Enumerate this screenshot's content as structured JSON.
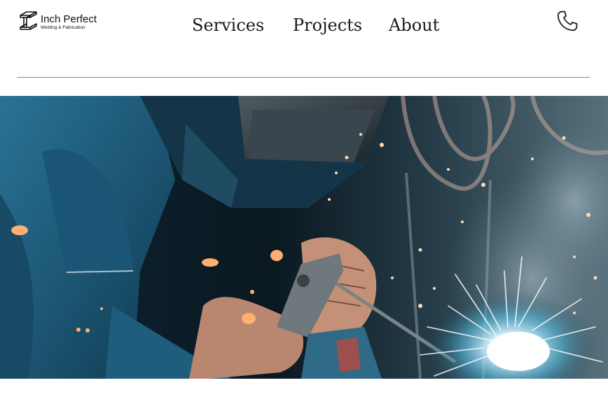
{
  "brand": {
    "name": "Inch Perfect",
    "tagline": "Welding & Fabrication",
    "logo_icon": "i-beam-logo-icon"
  },
  "nav": {
    "items": [
      {
        "label": "Services"
      },
      {
        "label": "Projects"
      },
      {
        "label": "About"
      }
    ]
  },
  "header": {
    "phone_icon": "phone-icon"
  },
  "hero": {
    "image": "welder-at-work-hero-image",
    "colors": {
      "dark": "#0b1a24",
      "blue": "#1d5a78",
      "accent": "#ff9a4a",
      "spark": "#eaf6ff"
    }
  }
}
